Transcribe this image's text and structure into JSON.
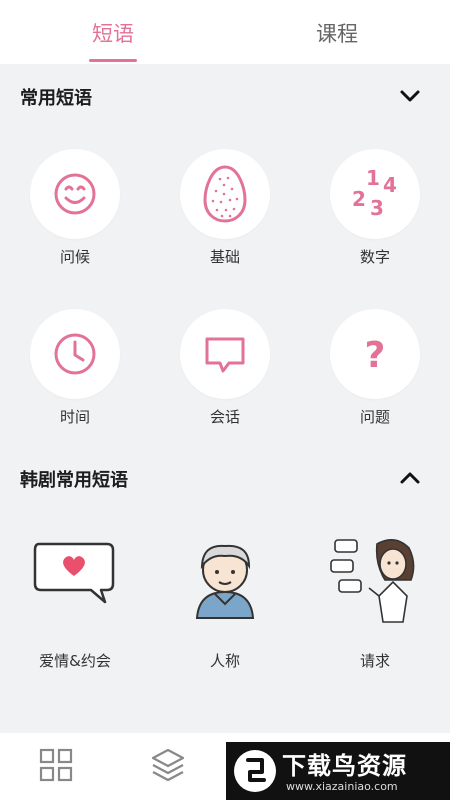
{
  "tabs": [
    {
      "label": "短语",
      "active": true
    },
    {
      "label": "课程",
      "active": false
    }
  ],
  "section1": {
    "title": "常用短语",
    "items": [
      {
        "label": "问候",
        "icon": "smiley-icon"
      },
      {
        "label": "基础",
        "icon": "egg-icon"
      },
      {
        "label": "数字",
        "icon": "numbers-icon"
      },
      {
        "label": "时间",
        "icon": "clock-icon"
      },
      {
        "label": "会话",
        "icon": "chat-icon"
      },
      {
        "label": "问题",
        "icon": "question-icon"
      }
    ]
  },
  "section2": {
    "title": "韩剧常用短语",
    "items": [
      {
        "label": "爱情&约会",
        "icon": "heart-bubble-icon"
      },
      {
        "label": "人称",
        "icon": "person-icon"
      },
      {
        "label": "请求",
        "icon": "girl-speech-icon"
      }
    ]
  },
  "icon_numbers_text": [
    "1",
    "4",
    "2",
    "3"
  ],
  "icon_question_text": "?",
  "watermark": {
    "title": "下载鸟资源",
    "url": "www.xiazainiao.com"
  },
  "colors": {
    "accent": "#e27396",
    "background": "#f1f2f4"
  }
}
